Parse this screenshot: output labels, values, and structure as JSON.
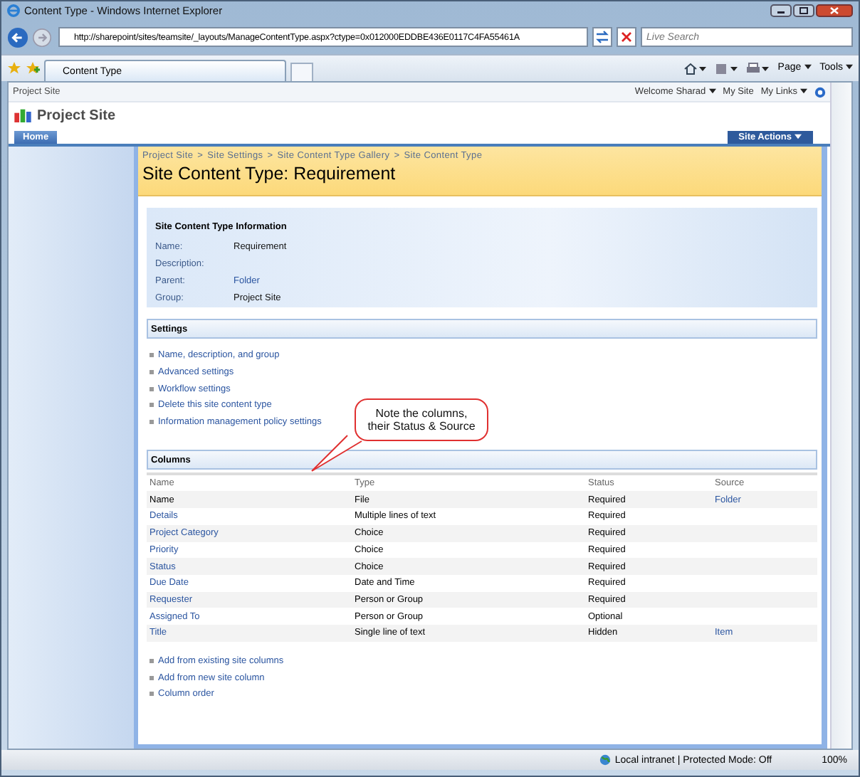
{
  "window": {
    "title": "Content Type - Windows Internet Explorer"
  },
  "address_bar": {
    "url": "http://sharepoint/sites/teamsite/_layouts/ManageContentType.aspx?ctype=0x012000EDDBE436E0117C4FA55461A",
    "search_placeholder": "Live Search"
  },
  "browser_tab": {
    "label": "Content Type",
    "selected": true
  },
  "toolbar": [
    "Page",
    "Tools"
  ],
  "page": {
    "top_link": "Project Site",
    "user_menu": [
      {
        "label": "Welcome Sharad",
        "dropdown": true
      },
      {
        "label": "My Site",
        "dropdown": false
      },
      {
        "label": "My Links",
        "dropdown": true
      }
    ],
    "site_title": "Project Site",
    "nav_tabs": [
      {
        "label": "Home",
        "selected": true
      }
    ],
    "site_actions": "Site Actions",
    "breadcrumb_separator": ">",
    "breadcrumb": [
      "Project Site",
      "Site Settings",
      "Site Content Type Gallery",
      "Site Content Type"
    ],
    "page_title": "Site Content Type: Requirement",
    "info": {
      "heading": "Site Content Type Information",
      "fields": [
        {
          "label": "Name:",
          "value": "Requirement",
          "linked": false
        },
        {
          "label": "Description:"
        },
        {
          "label": "Parent:",
          "value": "Folder",
          "linked": true
        },
        {
          "label": "Group:",
          "value": "Project Site",
          "linked": false
        }
      ]
    },
    "settings": {
      "heading": "Settings",
      "links": [
        "Name, description, and group",
        "Advanced settings",
        "Workflow settings",
        "Delete this site content type",
        "Information management policy settings"
      ]
    },
    "columns": {
      "heading": "Columns",
      "headers": [
        "Name",
        "Type",
        "Status",
        "Source"
      ],
      "rows": [
        {
          "name": "Name",
          "linked": false,
          "type": "File",
          "status": "Required",
          "source": "Folder"
        },
        {
          "name": "Details",
          "linked": true,
          "type": "Multiple lines of text",
          "status": "Required"
        },
        {
          "name": "Project Category",
          "linked": true,
          "type": "Choice",
          "status": "Required"
        },
        {
          "name": "Priority",
          "linked": true,
          "type": "Choice",
          "status": "Required"
        },
        {
          "name": "Status",
          "linked": true,
          "type": "Choice",
          "status": "Required"
        },
        {
          "name": "Due Date",
          "linked": true,
          "type": "Date and Time",
          "status": "Required"
        },
        {
          "name": "Requester",
          "linked": true,
          "type": "Person or Group",
          "status": "Required"
        },
        {
          "name": "Assigned To",
          "linked": true,
          "type": "Person or Group",
          "status": "Optional"
        },
        {
          "name": "Title",
          "linked": true,
          "type": "Single line of text",
          "status": "Hidden",
          "source": "Item"
        }
      ]
    },
    "column_links": [
      "Add from existing site columns",
      "Add from new site column",
      "Column order"
    ],
    "callout": [
      "Note the columns,",
      "their Status & Source"
    ]
  },
  "status_bar": {
    "zone": "Local intranet | Protected Mode: Off",
    "zoom": "100%"
  }
}
